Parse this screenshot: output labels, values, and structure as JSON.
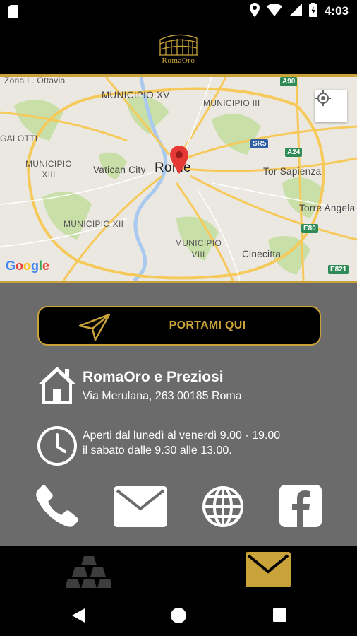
{
  "status_bar": {
    "time": "4:03",
    "icons": [
      "sd-card-icon",
      "location-icon",
      "wifi-icon",
      "signal-icon",
      "battery-icon"
    ]
  },
  "header": {
    "logo_text": "RomaOro"
  },
  "map": {
    "labels": {
      "zona": "Zona L. Ottavia",
      "municipio_xv": "MUNICIPIO XV",
      "municipio_iii": "MUNICIPIO III",
      "galotti": "GALOTTI",
      "municipio_xiii": "MUNICIPIO\nXIII",
      "vatican": "Vatican City",
      "rome": "Rome",
      "tor_sapienza": "Tor Sapienza",
      "torre_angela": "Torre Angela",
      "municipio_xii": "MUNICIPIO XII",
      "municipio_viii": "MUNICIPIO\nVIII",
      "cinecitta": "Cinecitta"
    },
    "shields": {
      "a90": "A90",
      "sr5": "SR5",
      "a24": "A24",
      "e80": "E80",
      "e821": "E821"
    },
    "google": "Google"
  },
  "actions": {
    "navigate_label": "PORTAMI QUI"
  },
  "store": {
    "name": "RomaOro e Preziosi",
    "address": "Via Merulana, 263 00185 Roma",
    "hours_line1": "Aperti dal lunedì al venerdì 9.00 - 19.00",
    "hours_line2": "il sabato dalle 9.30 alle 13.00."
  },
  "colors": {
    "gold": "#c9a23a",
    "panel": "#6b6b6b",
    "background": "#000000"
  }
}
